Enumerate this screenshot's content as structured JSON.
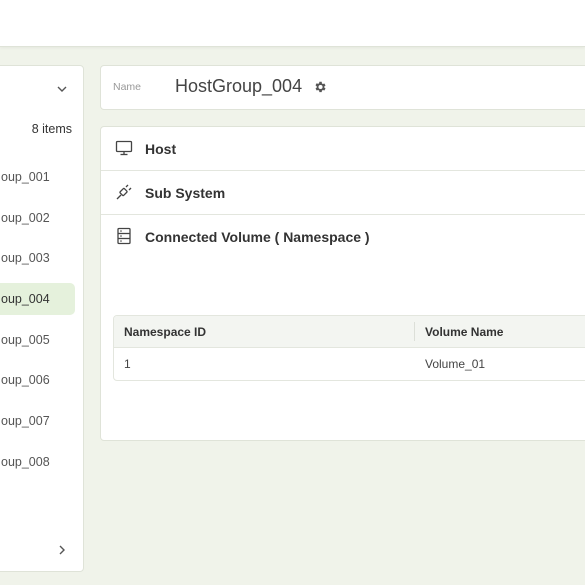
{
  "left_panel": {
    "items_count": "8 items",
    "groups": [
      {
        "label": "oup_001",
        "selected": false
      },
      {
        "label": "oup_002",
        "selected": false
      },
      {
        "label": "oup_003",
        "selected": false
      },
      {
        "label": "oup_004",
        "selected": true
      },
      {
        "label": "oup_005",
        "selected": false
      },
      {
        "label": "oup_006",
        "selected": false
      },
      {
        "label": "oup_007",
        "selected": false
      },
      {
        "label": "oup_008",
        "selected": false
      }
    ]
  },
  "name_card": {
    "label": "Name",
    "value": "HostGroup_004"
  },
  "sections": {
    "host": "Host",
    "subsystem": "Sub System",
    "volume": "Connected Volume ( Namespace )"
  },
  "namespace_table": {
    "headers": [
      "Namespace ID",
      "Volume Name"
    ],
    "rows": [
      [
        "1",
        "Volume_01"
      ]
    ]
  },
  "icons": {
    "collapse": "chevron-down-icon",
    "next": "chevron-right-icon",
    "settings": "gear-icon",
    "host": "monitor-icon",
    "subsystem": "plug-icon",
    "volume": "server-icon"
  }
}
